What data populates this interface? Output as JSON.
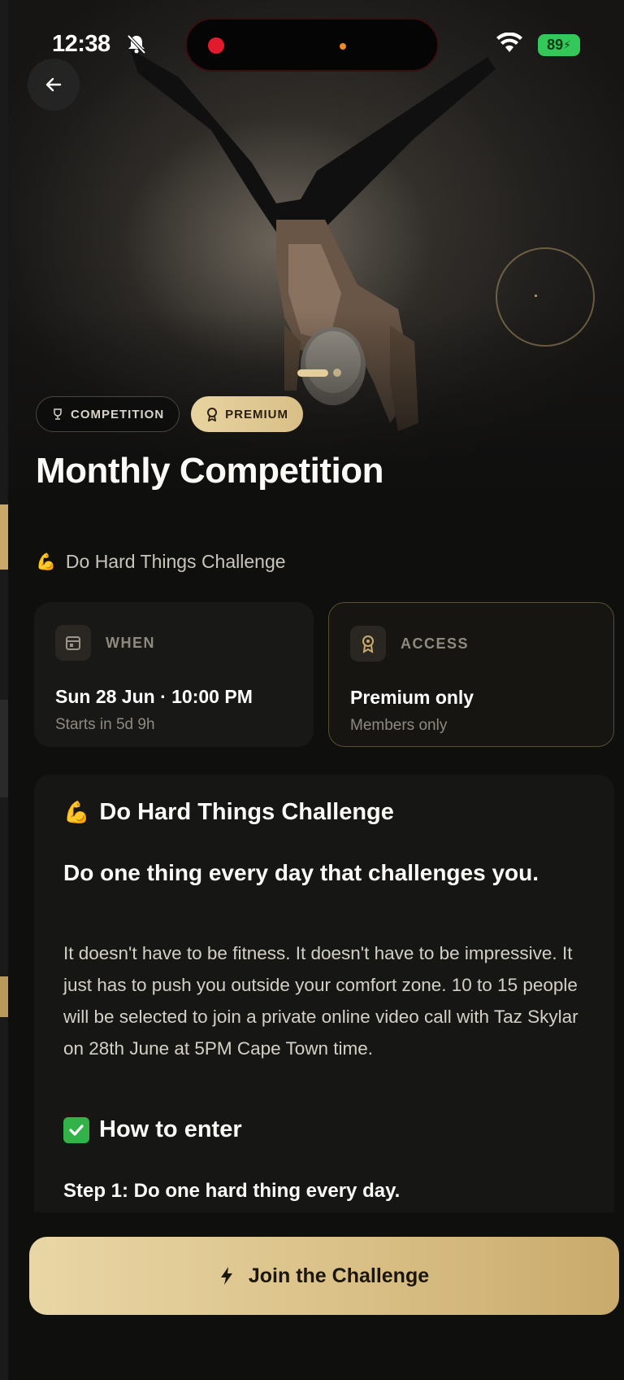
{
  "status_bar": {
    "time": "12:38",
    "battery": "89"
  },
  "hero": {
    "tags": {
      "competition": "COMPETITION",
      "premium": "PREMIUM"
    },
    "title": "Monthly Competition",
    "subtitle": "Do Hard Things Challenge",
    "subtitle_emoji": "💪"
  },
  "info": {
    "when": {
      "label": "WHEN",
      "main": "Sun 28 Jun · 10:00 PM",
      "sub": "Starts in 5d 9h"
    },
    "access": {
      "label": "ACCESS",
      "main": "Premium only",
      "sub": "Members only"
    }
  },
  "description": {
    "heading": "Do Hard Things Challenge",
    "heading_emoji": "💪",
    "lead": "Do one thing every day that challenges you.",
    "body": "It doesn't have to be fitness. It doesn't have to be impressive. It just has to push you outside your comfort zone. 10 to 15 people will be selected to join a private online video call with Taz Skylar on 28th June at 5PM Cape Town time.",
    "how_to_heading": "How to enter",
    "step1": "Step 1: Do one hard thing every day."
  },
  "cta": {
    "label": "Join the Challenge"
  },
  "colors": {
    "accent_gold": "#d9bf87",
    "background": "#0f0f0e",
    "record_red": "#e21b2c",
    "battery_green": "#34c759"
  }
}
